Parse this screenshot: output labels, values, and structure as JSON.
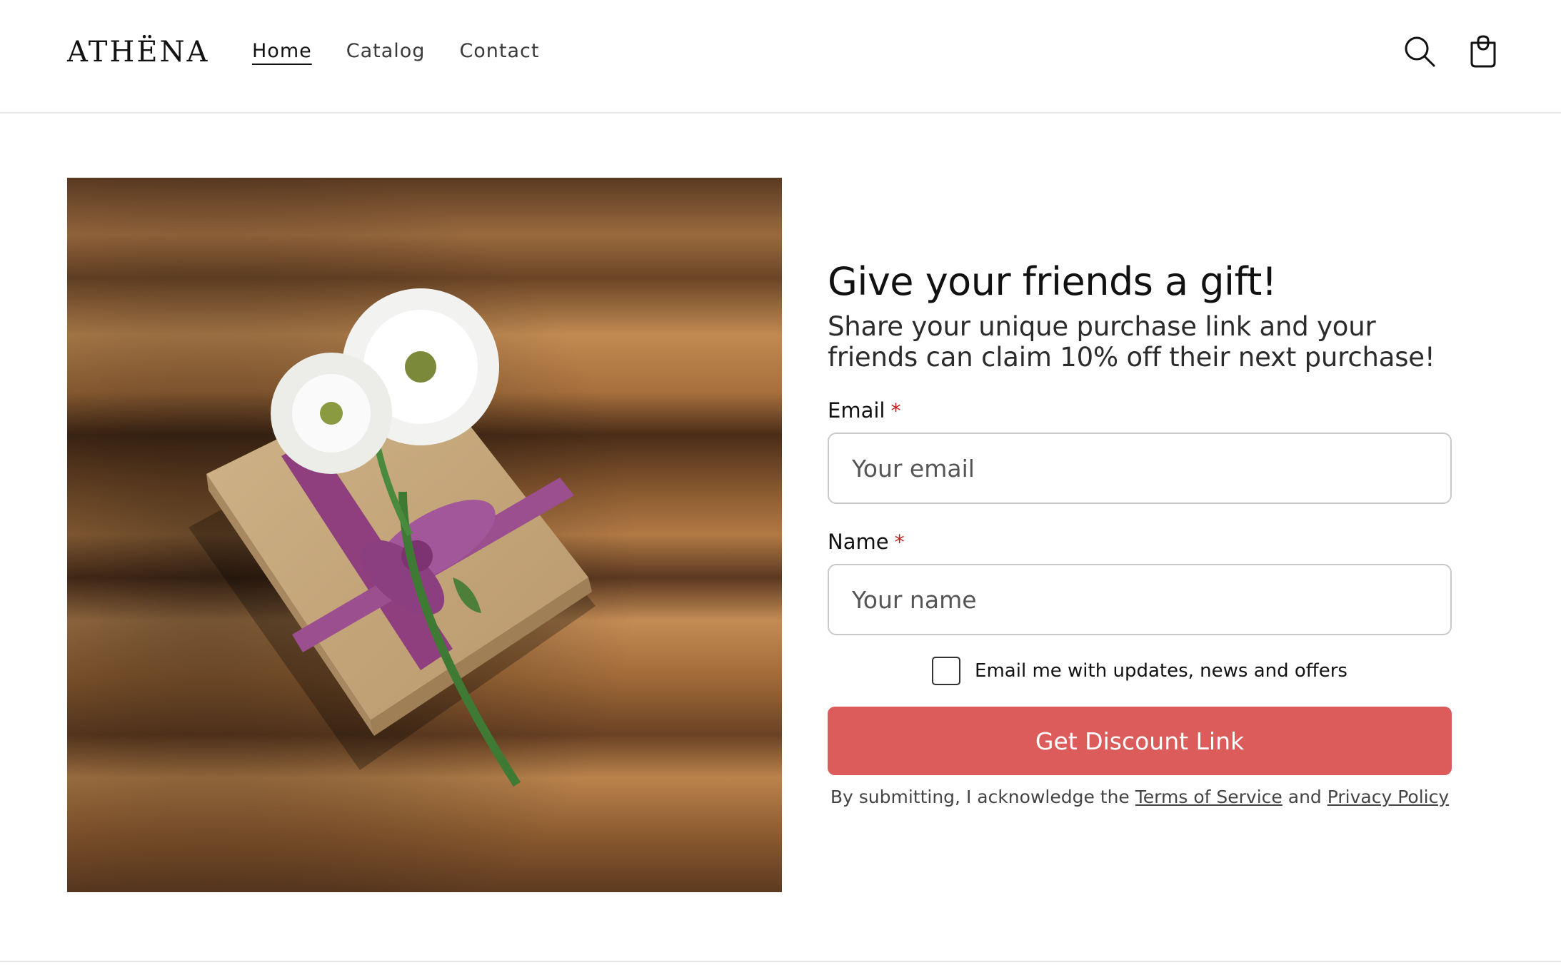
{
  "header": {
    "logo": "ATHËNA",
    "nav": [
      {
        "label": "Home",
        "active": true
      },
      {
        "label": "Catalog",
        "active": false
      },
      {
        "label": "Contact",
        "active": false
      }
    ],
    "icons": [
      "search-icon",
      "cart-icon"
    ]
  },
  "hero": {
    "image": "gift-box-with-white-flowers"
  },
  "form": {
    "title": "Give your friends a gift!",
    "subtitle": "Share your unique purchase link and your friends can claim 10% off their next purchase!",
    "email_label": "Email",
    "email_placeholder": "Your email",
    "name_label": "Name",
    "name_placeholder": "Your name",
    "required_mark": "*",
    "checkbox_label": "Email me with updates, news and offers",
    "checkbox_checked": false,
    "submit_label": "Get Discount Link",
    "legal_prefix": "By submitting, I acknowledge the",
    "terms_label": "Terms of Service",
    "legal_and": "and",
    "privacy_label": "Privacy Policy"
  },
  "colors": {
    "button": "#dc5c5c",
    "required": "#c41e1e",
    "ribbon": "#9b4f8f",
    "box": "#c6a77d"
  }
}
